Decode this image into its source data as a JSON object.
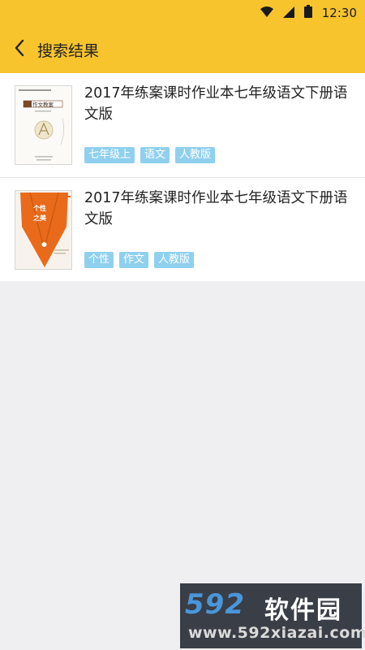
{
  "status_bar": {
    "time": "12:30",
    "icons": [
      "wifi-icon",
      "cell-signal-icon",
      "battery-icon"
    ]
  },
  "app_bar": {
    "back_icon": "chevron-left-icon",
    "title": "搜索结果",
    "background": "#f7c42d"
  },
  "results": [
    {
      "title": "2017年练案课时作业本七年级语文下册语文版",
      "cover": {
        "name": "book-cover-yuwen",
        "text": "语文作文教案"
      },
      "tags": [
        "七年级上",
        "语文",
        "人教版"
      ]
    },
    {
      "title": "2017年练案课时作业本七年级语文下册语文版",
      "cover": {
        "name": "book-cover-gexing",
        "text": "个性之美"
      },
      "tags": [
        "个性",
        "作文",
        "人教版"
      ]
    }
  ],
  "colors": {
    "accent": "#f7c42d",
    "tag_bg": "#8fd0ee",
    "page_bg": "#efeff1"
  },
  "watermark": {
    "logo": "592",
    "name": "软件园",
    "url": "www.592xiazai.com"
  }
}
